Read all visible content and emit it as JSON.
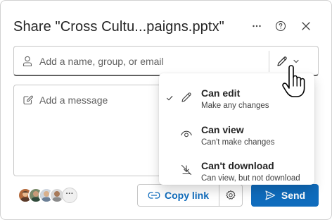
{
  "dialog": {
    "title": "Share \"Cross Cultu...paigns.pptx\"",
    "more_icon": "more-horizontal-icon",
    "help_icon": "help-circle-icon",
    "close_icon": "dismiss-icon"
  },
  "recipients": {
    "placeholder": "Add a name, group, or email",
    "icon": "person-icon",
    "permission_icon": "pencil-icon"
  },
  "message": {
    "placeholder": "Add a message",
    "icon": "compose-icon"
  },
  "permissions_menu": {
    "items": [
      {
        "label": "Can edit",
        "description": "Make any changes",
        "icon": "pencil-icon",
        "selected": true
      },
      {
        "label": "Can view",
        "description": "Can't make changes",
        "icon": "eye-icon",
        "selected": false
      },
      {
        "label": "Can't download",
        "description": "Can view, but not download",
        "icon": "download-blocked-icon",
        "selected": false
      }
    ]
  },
  "footer": {
    "avatars_more": "···",
    "copy_link_label": "Copy link",
    "send_label": "Send"
  },
  "colors": {
    "accent": "#0f6cbd",
    "border": "#c7c7c7",
    "text": "#242424",
    "placeholder": "#616161"
  }
}
